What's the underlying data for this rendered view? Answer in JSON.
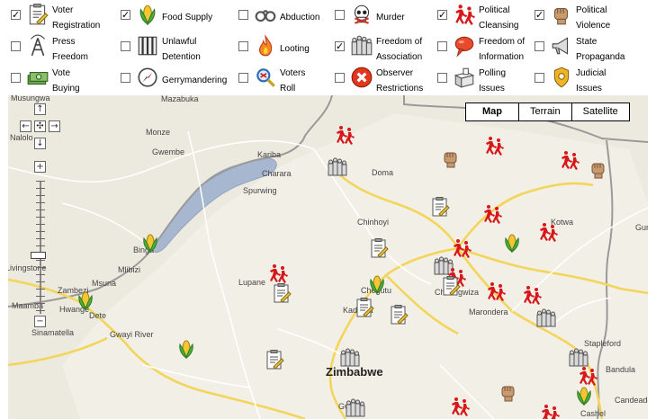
{
  "filters": [
    {
      "label": "Voter Registration",
      "lines": [
        "Voter",
        "Registration"
      ],
      "checked": true,
      "icon": "clipboard-icon"
    },
    {
      "label": "Food Supply",
      "lines": [
        "Food Supply"
      ],
      "checked": true,
      "icon": "corn-icon"
    },
    {
      "label": "Abduction",
      "lines": [
        "Abduction"
      ],
      "checked": false,
      "icon": "handcuffs-icon"
    },
    {
      "label": "Murder",
      "lines": [
        "Murder"
      ],
      "checked": false,
      "icon": "skull-icon"
    },
    {
      "label": "Political Cleansing",
      "lines": [
        "Political",
        "Cleansing"
      ],
      "checked": true,
      "icon": "running-people-icon"
    },
    {
      "label": "Political Violence",
      "lines": [
        "Political",
        "Violence"
      ],
      "checked": true,
      "icon": "fist-icon"
    },
    {
      "label": "Press Freedom",
      "lines": [
        "Press",
        "Freedom"
      ],
      "checked": false,
      "icon": "antenna-icon"
    },
    {
      "label": "Unlawful Detention",
      "lines": [
        "Unlawful",
        "Detention"
      ],
      "checked": false,
      "icon": "jail-icon"
    },
    {
      "label": "Looting",
      "lines": [
        "Looting"
      ],
      "checked": false,
      "icon": "fire-icon"
    },
    {
      "label": "Freedom of Association",
      "lines": [
        "Freedom of",
        "Association"
      ],
      "checked": true,
      "icon": "crowd-icon"
    },
    {
      "label": "Freedom of Information",
      "lines": [
        "Freedom of",
        "Information"
      ],
      "checked": false,
      "icon": "speech-bubble-icon"
    },
    {
      "label": "State Propaganda",
      "lines": [
        "State",
        "Propaganda"
      ],
      "checked": false,
      "icon": "megaphone-icon"
    },
    {
      "label": "Vote Buying",
      "lines": [
        "Vote",
        "Buying"
      ],
      "checked": false,
      "icon": "money-icon"
    },
    {
      "label": "Gerrymandering",
      "lines": [
        "Gerrymandering"
      ],
      "checked": false,
      "icon": "compass-icon"
    },
    {
      "label": "Voters Roll",
      "lines": [
        "Voters",
        "Roll"
      ],
      "checked": false,
      "icon": "magnifier-icon"
    },
    {
      "label": "Observer Restrictions",
      "lines": [
        "Observer",
        "Restrictions"
      ],
      "checked": false,
      "icon": "no-entry-icon"
    },
    {
      "label": "Polling Issues",
      "lines": [
        "Polling",
        "Issues"
      ],
      "checked": false,
      "icon": "ballot-box-icon"
    },
    {
      "label": "Judicial Issues",
      "lines": [
        "Judicial",
        "Issues"
      ],
      "checked": false,
      "icon": "badge-icon"
    }
  ],
  "map": {
    "map_types": [
      "Map",
      "Terrain",
      "Satellite"
    ],
    "selected_type": "Map",
    "country_label": "Zimbabwe",
    "places": [
      "Musungwa",
      "Mazabuka",
      "Nalolo",
      "Monze",
      "Gwembe",
      "Kariba",
      "Charara",
      "Spurwing",
      "Doma",
      "Chinhoyi",
      "Binga",
      "Mlibizi",
      "Zambezi",
      "Msuna",
      "Hwange",
      "Dete",
      "Sinamatella",
      "Gwayi River",
      "Lupane",
      "Kadoma",
      "Chegutu",
      "Chitungwiza",
      "Marondera",
      "Kotwa",
      "Guro",
      "Stapleford",
      "Bandula",
      "Candeado",
      "Cashel",
      "Gweru",
      "Livingstone",
      "Maamba"
    ]
  },
  "nav": {
    "pan_up": "↑",
    "pan_down": "↓",
    "pan_left": "←",
    "pan_right": "→",
    "center": "✣",
    "zoom_in": "+",
    "zoom_out": "−"
  }
}
